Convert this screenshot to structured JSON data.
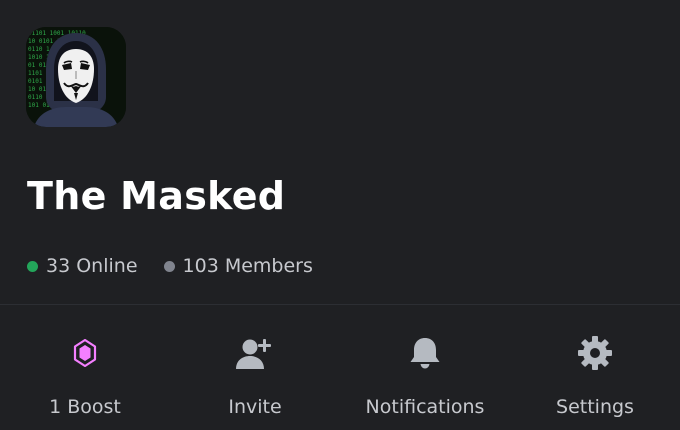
{
  "server": {
    "name": "The Masked",
    "icon": "masked-hacker-server-icon"
  },
  "stats": {
    "online": "33 Online",
    "members": "103 Members",
    "online_color": "#23a55a",
    "members_color": "#80848e"
  },
  "actions": [
    {
      "label": "1 Boost",
      "icon": "boost-gem-icon",
      "color": "#f47fff"
    },
    {
      "label": "Invite",
      "icon": "add-user-icon",
      "color": "#b5bac1"
    },
    {
      "label": "Notifications",
      "icon": "bell-icon",
      "color": "#b5bac1"
    },
    {
      "label": "Settings",
      "icon": "gear-icon",
      "color": "#b5bac1"
    }
  ]
}
